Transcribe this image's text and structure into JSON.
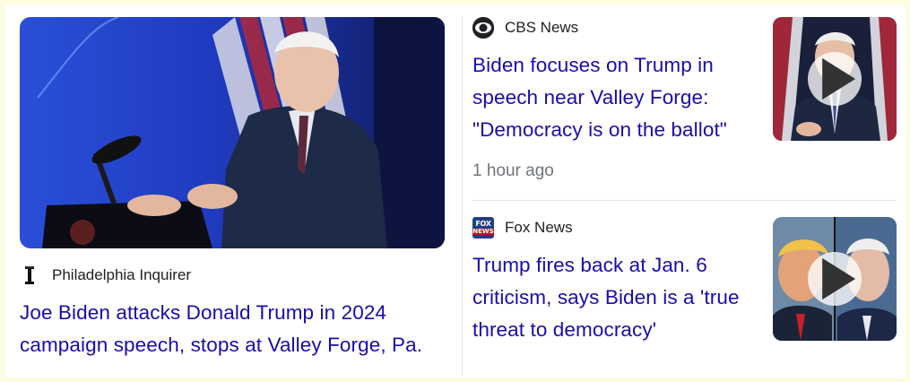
{
  "lead_story": {
    "source": "Philadelphia Inquirer",
    "headline": "Joe Biden attacks Donald Trump in 2024 campaign speech, stops at Valley Forge, Pa.",
    "source_icon": "inquirer-logo"
  },
  "stories": [
    {
      "source": "CBS News",
      "source_icon": "cbs-eye-logo",
      "headline": "Biden focuses on Trump in speech near Valley Forge: \"Democracy is on the ballot\"",
      "timestamp": "1 hour ago",
      "thumbnail_icon": "play-icon"
    },
    {
      "source": "Fox News",
      "source_icon": "fox-news-logo",
      "headline": "Trump fires back at Jan. 6 criticism, says Biden is a 'true threat to democracy'",
      "thumbnail_icon": "play-icon"
    }
  ],
  "colors": {
    "link": "#1a0dab",
    "meta": "#70757a",
    "background": "#fdfde0"
  }
}
